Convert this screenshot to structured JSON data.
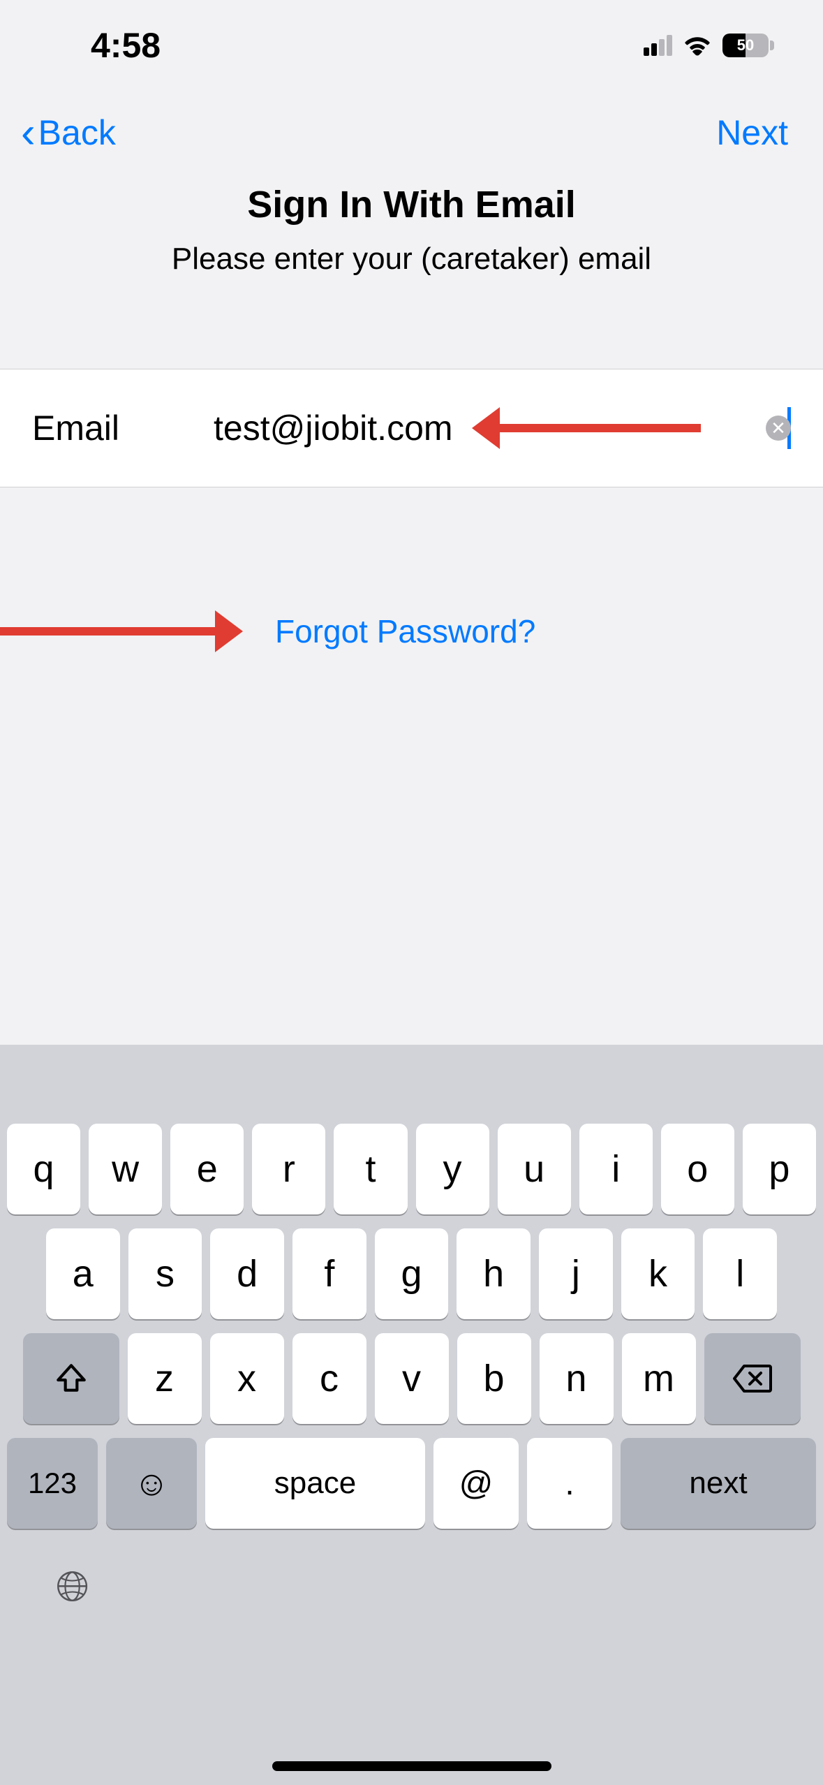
{
  "status": {
    "time": "4:58",
    "battery": "50"
  },
  "nav": {
    "back": "Back",
    "next": "Next"
  },
  "page": {
    "title": "Sign In With Email",
    "subtitle": "Please enter your (caretaker) email"
  },
  "form": {
    "email_label": "Email",
    "email_value": "test@jiobit.com"
  },
  "links": {
    "forgot": "Forgot Password?"
  },
  "keyboard": {
    "row1": [
      "q",
      "w",
      "e",
      "r",
      "t",
      "y",
      "u",
      "i",
      "o",
      "p"
    ],
    "row2": [
      "a",
      "s",
      "d",
      "f",
      "g",
      "h",
      "j",
      "k",
      "l"
    ],
    "row3": [
      "z",
      "x",
      "c",
      "v",
      "b",
      "n",
      "m"
    ],
    "numbers": "123",
    "space": "space",
    "at": "@",
    "dot": ".",
    "next": "next"
  }
}
